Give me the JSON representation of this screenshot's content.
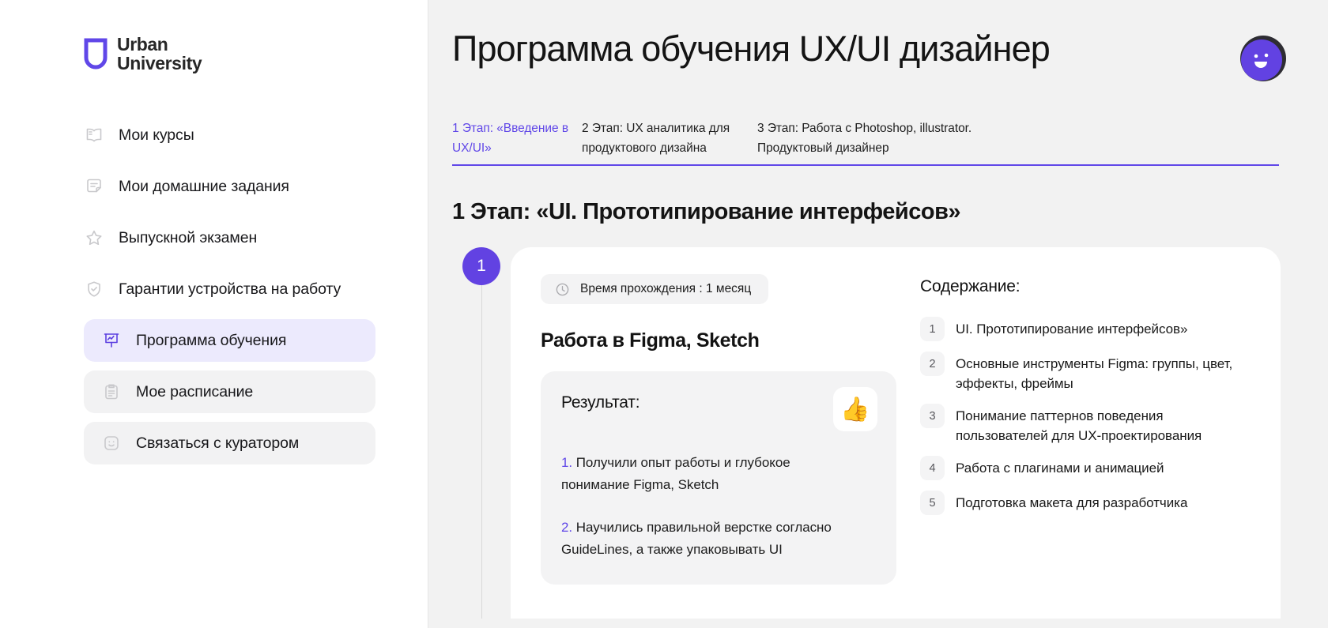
{
  "brand": {
    "logo_line1": "Urban",
    "logo_line2": "University",
    "accent": "#6047e8",
    "logo_mark_icon": "shield-u-logo-icon"
  },
  "sidebar": {
    "items": [
      {
        "label": "Мои курсы",
        "icon": "book-icon",
        "state": "plain"
      },
      {
        "label": "Мои домашние задания",
        "icon": "note-icon",
        "state": "plain"
      },
      {
        "label": "Выпускной экзамен",
        "icon": "star-icon",
        "state": "plain"
      },
      {
        "label": "Гарантии устройства на работу",
        "icon": "shield-check-icon",
        "state": "plain"
      },
      {
        "label": "Программа обучения",
        "icon": "presentation-chart-icon",
        "state": "active"
      },
      {
        "label": "Мое расписание",
        "icon": "clipboard-icon",
        "state": "grey"
      },
      {
        "label": "Связаться с куратором",
        "icon": "smiley-icon",
        "state": "grey"
      }
    ]
  },
  "header": {
    "title": "Программа обучения UX/UI дизайнер",
    "avatar_icon": "user-avatar-smiley"
  },
  "tabs": [
    {
      "label": "1 Этап: «Введение в UX/UI»",
      "active": true
    },
    {
      "label": "2 Этап: UX аналитика для продуктового дизайна",
      "active": false
    },
    {
      "label": "3 Этап: Работа с Photoshop, illustrator. Продуктовый дизайнер",
      "active": false
    }
  ],
  "section": {
    "title": "1 Этап: «UI. Прототипирование интерфейсов»",
    "step_badge": "1"
  },
  "card": {
    "time_icon": "clock-icon",
    "time_label": "Время прохождения : 1 месяц",
    "block_title": "Работа в Figma, Sketch",
    "result": {
      "label": "Результат:",
      "emoji": "👍",
      "emoji_icon": "thumbs-up-icon",
      "items": [
        {
          "num": "1.",
          "text": " Получили опыт работы и глубокое понимание Figma, Sketch"
        },
        {
          "num": "2.",
          "text": " Научились правильной верстке согласно GuideLines, а также упаковывать UI"
        }
      ]
    },
    "contents": {
      "title": "Содержание:",
      "items": [
        {
          "num": "1",
          "text": "UI. Прототипирование интерфейсов»"
        },
        {
          "num": "2",
          "text": "Основные инструменты Figma: группы, цвет, эффекты, фреймы"
        },
        {
          "num": "3",
          "text": "Понимание паттернов поведения пользователей для UX-проектирования"
        },
        {
          "num": "4",
          "text": "Работа с плагинами и анимацией"
        },
        {
          "num": "5",
          "text": "Подготовка макета для разработчика"
        }
      ]
    }
  }
}
